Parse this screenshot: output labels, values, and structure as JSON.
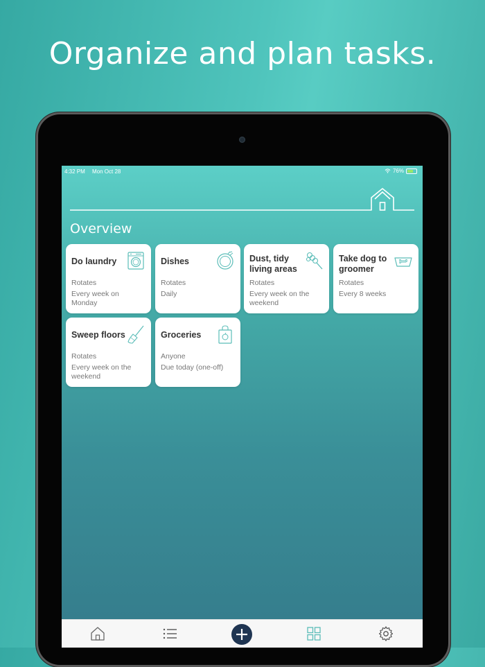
{
  "marketing": {
    "headline": "Organize and plan tasks."
  },
  "status_bar": {
    "time": "4:32 PM",
    "date": "Mon Oct 28",
    "battery": "76%"
  },
  "colors": {
    "accent": "#4fc4bc",
    "card": "#ffffff",
    "add_button": "#1f3552",
    "icon_stroke": "#5bbdb8"
  },
  "section_title": "Overview",
  "tasks": [
    {
      "title": "Do laundry",
      "assignee": "Rotates",
      "schedule": "Every week on Monday",
      "icon": "washing-machine-icon"
    },
    {
      "title": "Dishes",
      "assignee": "Rotates",
      "schedule": "Daily",
      "icon": "plate-icon"
    },
    {
      "title": "Dust, tidy living areas",
      "assignee": "Rotates",
      "schedule": "Every week on the weekend",
      "icon": "duster-icon"
    },
    {
      "title": "Take dog to groomer",
      "assignee": "Rotates",
      "schedule": "Every 8 weeks",
      "icon": "dog-bowl-icon"
    },
    {
      "title": "Sweep floors",
      "assignee": "Rotates",
      "schedule": "Every week on the weekend",
      "icon": "broom-icon"
    },
    {
      "title": "Groceries",
      "assignee": "Anyone",
      "schedule": "Due today (one-off)",
      "icon": "shopping-bag-icon"
    }
  ],
  "tab_bar": [
    "home-icon",
    "list-icon",
    "add-icon",
    "grid-icon",
    "settings-icon"
  ]
}
